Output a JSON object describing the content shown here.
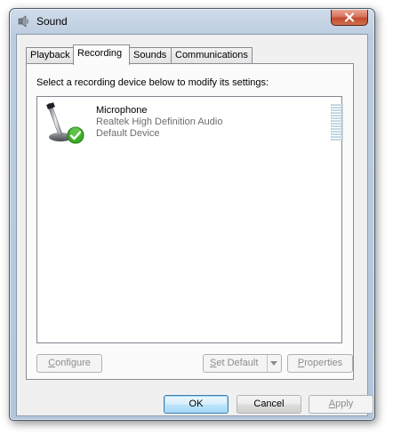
{
  "window": {
    "title": "Sound"
  },
  "tabs": [
    {
      "label": "Playback",
      "active": false
    },
    {
      "label": "Recording",
      "active": true
    },
    {
      "label": "Sounds",
      "active": false
    },
    {
      "label": "Communications",
      "active": false
    }
  ],
  "panel": {
    "instruction": "Select a recording device below to modify its settings:",
    "devices": [
      {
        "name": "Microphone",
        "driver": "Realtek High Definition Audio",
        "status": "Default Device",
        "icon": "microphone-icon",
        "badge": "default-check-icon",
        "level": 0
      }
    ],
    "buttons": {
      "configure": {
        "pre": "",
        "accel": "C",
        "post": "onfigure"
      },
      "set_default": {
        "pre": "",
        "accel": "S",
        "post": "et Default"
      },
      "properties": {
        "pre": "",
        "accel": "P",
        "post": "roperties"
      }
    }
  },
  "footer": {
    "ok": "OK",
    "cancel": "Cancel",
    "apply": {
      "pre": "",
      "accel": "A",
      "post": "pply"
    }
  },
  "colors": {
    "accent_check": "#3fae28",
    "window_frame": "#b3c6dc",
    "close_button": "#c24a2f"
  }
}
